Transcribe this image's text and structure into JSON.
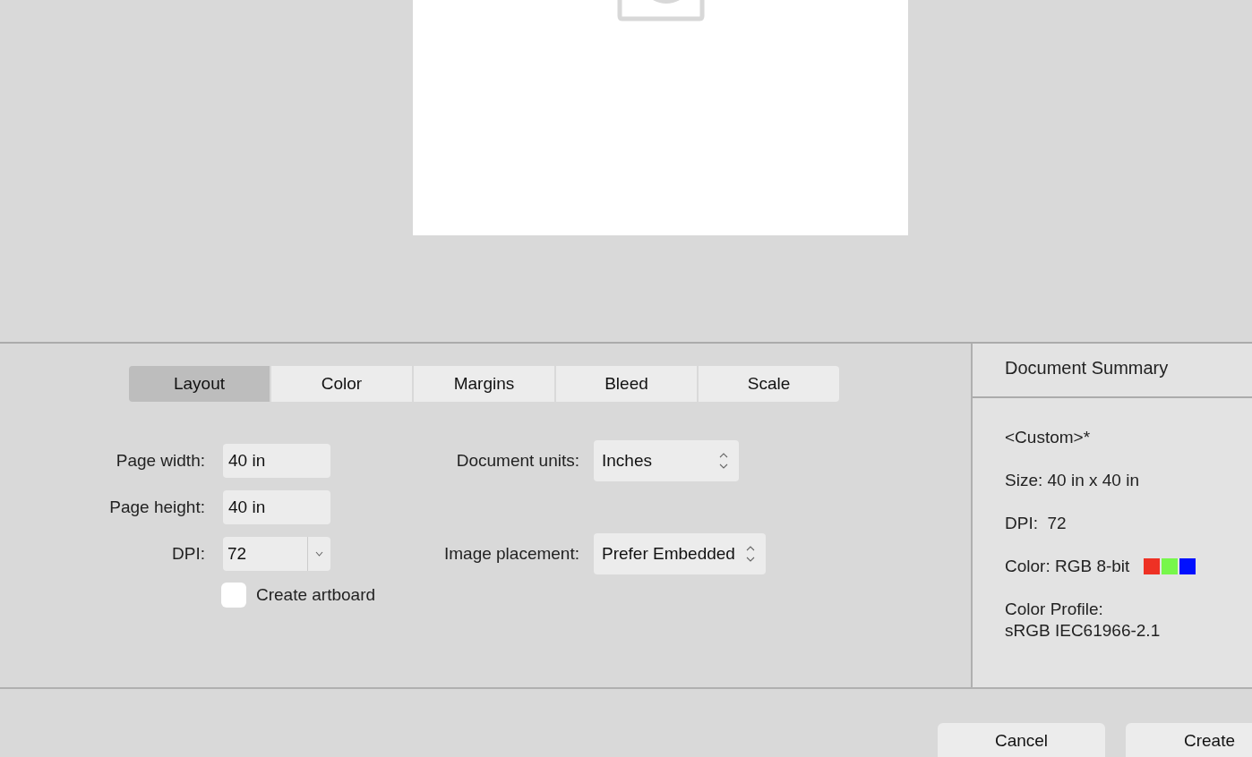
{
  "tabs": [
    {
      "label": "Layout",
      "selected": true
    },
    {
      "label": "Color",
      "selected": false
    },
    {
      "label": "Margins",
      "selected": false
    },
    {
      "label": "Bleed",
      "selected": false
    },
    {
      "label": "Scale",
      "selected": false
    }
  ],
  "fields": [
    {
      "kind": "text",
      "label": "Page width:",
      "value": "40 in"
    },
    {
      "kind": "text",
      "label": "Page height:",
      "value": "40 in"
    },
    {
      "kind": "combo",
      "label": "DPI:",
      "value": "72"
    }
  ],
  "popups": [
    {
      "label": "Document units:",
      "value": "Inches"
    },
    {
      "label": "Image placement:",
      "value": "Prefer Embedded"
    }
  ],
  "create_artboard": {
    "label": "Create artboard",
    "checked": false
  },
  "summary": {
    "title": "Document Summary",
    "preset": "<Custom>*",
    "size": "Size: 40 in x 40 in",
    "dpi": "DPI:  72",
    "color_mode": "Color: RGB 8-bit",
    "swatches": [
      {
        "color": "#ee3124"
      },
      {
        "color": "#77f74b"
      },
      {
        "color": "#0010ff"
      }
    ],
    "profile_label": "Color Profile:",
    "profile": "sRGB IEC61966-2.1"
  },
  "buttons": [
    "Cancel",
    "Create"
  ]
}
